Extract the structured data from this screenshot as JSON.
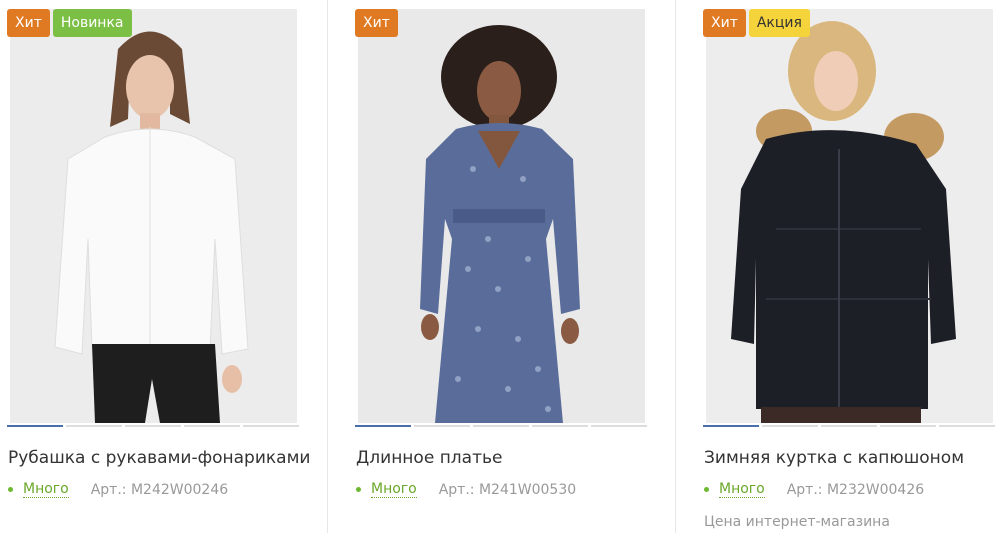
{
  "products": [
    {
      "badges": [
        "Хит",
        "Новинка"
      ],
      "title": "Рубашка с рукавами-фонариками",
      "stock": "Много",
      "sku": "Арт.: M242W00246",
      "image": "woman-white-blouse"
    },
    {
      "badges": [
        "Хит"
      ],
      "title": "Длинное платье",
      "stock": "Много",
      "sku": "Арт.: M241W00530",
      "image": "woman-blue-floral-dress"
    },
    {
      "badges": [
        "Хит",
        "Акция"
      ],
      "title": "Зимняя куртка с капюшоном",
      "stock": "Много",
      "sku": "Арт.: M232W00426",
      "price_label": "Цена интернет-магазина",
      "image": "woman-black-winter-jacket"
    }
  ],
  "colors": {
    "badge_hit": "#e07a22",
    "badge_new": "#7cbf45",
    "badge_sale": "#f5d33b",
    "stock_green": "#6aa829",
    "slider_active": "#4a6ea9"
  }
}
